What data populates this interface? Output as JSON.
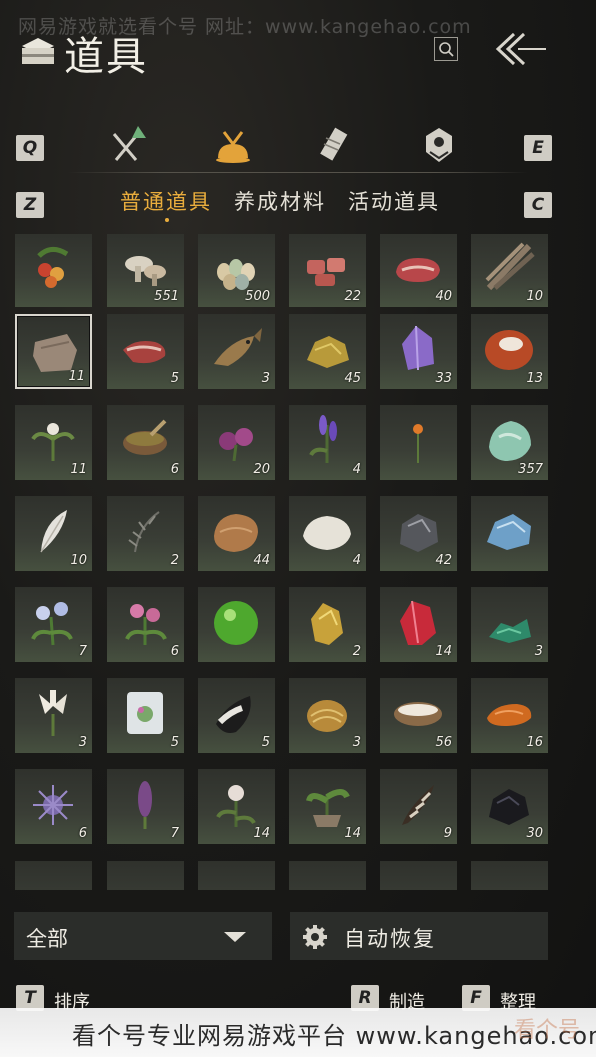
{
  "watermark": "网易游戏就选看个号  网址：www.kangehao.com",
  "header": {
    "title": "道具",
    "icon": "satchel-icon",
    "search_icon": "search-icon",
    "back_icon": "double-chevron-back-icon"
  },
  "category_nav": {
    "left_key": "Q",
    "right_key": "E",
    "tabs": [
      {
        "icon": "crossed-swords-icon",
        "active": false
      },
      {
        "icon": "pouch-icon",
        "active": true
      },
      {
        "icon": "scroll-icon",
        "active": false
      },
      {
        "icon": "gem-badge-icon",
        "active": false
      }
    ]
  },
  "sub_nav": {
    "left_key": "Z",
    "right_key": "C",
    "tabs": [
      {
        "label": "普通道具",
        "active": true
      },
      {
        "label": "养成材料",
        "active": false
      },
      {
        "label": "活动道具",
        "active": false
      }
    ]
  },
  "items": [
    {
      "icon": "berries-icon",
      "count": ""
    },
    {
      "icon": "mushrooms-icon",
      "count": "551"
    },
    {
      "icon": "eggs-icon",
      "count": "500"
    },
    {
      "icon": "raw-meat-chunks-icon",
      "count": "22"
    },
    {
      "icon": "steak-icon",
      "count": "40"
    },
    {
      "icon": "feathers-bundle-icon",
      "count": "10"
    },
    {
      "icon": "hide-icon",
      "count": "11",
      "selected": true
    },
    {
      "icon": "meat-slices-icon",
      "count": "5"
    },
    {
      "icon": "fish-icon",
      "count": "3"
    },
    {
      "icon": "gold-ore-icon",
      "count": "45"
    },
    {
      "icon": "amethyst-icon",
      "count": "33"
    },
    {
      "icon": "red-agate-icon",
      "count": "13"
    },
    {
      "icon": "white-herb-icon",
      "count": "11"
    },
    {
      "icon": "herb-bowl-icon",
      "count": "6"
    },
    {
      "icon": "purple-flower-icon",
      "count": "20"
    },
    {
      "icon": "lavender-icon",
      "count": "4"
    },
    {
      "icon": "orange-flower-icon",
      "count": ""
    },
    {
      "icon": "jade-stone-icon",
      "count": "357"
    },
    {
      "icon": "white-feather-icon",
      "count": "10"
    },
    {
      "icon": "grey-feather-icon",
      "count": "2"
    },
    {
      "icon": "brown-pelt-icon",
      "count": "44"
    },
    {
      "icon": "white-pelt-icon",
      "count": "4"
    },
    {
      "icon": "dark-ore-icon",
      "count": "42"
    },
    {
      "icon": "blue-crystal-icon",
      "count": ""
    },
    {
      "icon": "blue-flower-icon",
      "count": "7"
    },
    {
      "icon": "pink-flower-icon",
      "count": "6"
    },
    {
      "icon": "green-orb-icon",
      "count": ""
    },
    {
      "icon": "gold-nugget-icon",
      "count": "2"
    },
    {
      "icon": "ruby-icon",
      "count": "14"
    },
    {
      "icon": "green-shards-icon",
      "count": "3"
    },
    {
      "icon": "white-lily-icon",
      "count": "3"
    },
    {
      "icon": "ice-block-icon",
      "count": "5"
    },
    {
      "icon": "fur-tuft-icon",
      "count": "5"
    },
    {
      "icon": "golden-shell-icon",
      "count": "3"
    },
    {
      "icon": "milk-bowl-icon",
      "count": "56"
    },
    {
      "icon": "orange-stone-icon",
      "count": "16"
    },
    {
      "icon": "purple-urchin-icon",
      "count": "6"
    },
    {
      "icon": "purple-spike-flower-icon",
      "count": "7"
    },
    {
      "icon": "white-rose-icon",
      "count": "14"
    },
    {
      "icon": "potted-herb-icon",
      "count": "14"
    },
    {
      "icon": "striped-feather-icon",
      "count": "9"
    },
    {
      "icon": "black-ore-icon",
      "count": "30"
    },
    {
      "icon": "partial-item-icon",
      "count": ""
    },
    {
      "icon": "partial-item-icon",
      "count": ""
    },
    {
      "icon": "partial-item-icon",
      "count": ""
    },
    {
      "icon": "empty-slot",
      "count": ""
    },
    {
      "icon": "empty-slot",
      "count": ""
    },
    {
      "icon": "empty-slot",
      "count": ""
    }
  ],
  "filter": {
    "label": "全部",
    "icon": "caret-down-icon"
  },
  "auto_restore": {
    "label": "自动恢复",
    "icon": "gear-icon"
  },
  "bottom_actions": [
    {
      "key": "T",
      "label": "排序"
    },
    {
      "key": "R",
      "label": "制造"
    },
    {
      "key": "F",
      "label": "整理"
    }
  ],
  "banner": {
    "text": "看个号专业网易游戏平台   www.kangehao.com",
    "watermark": "看个号"
  }
}
